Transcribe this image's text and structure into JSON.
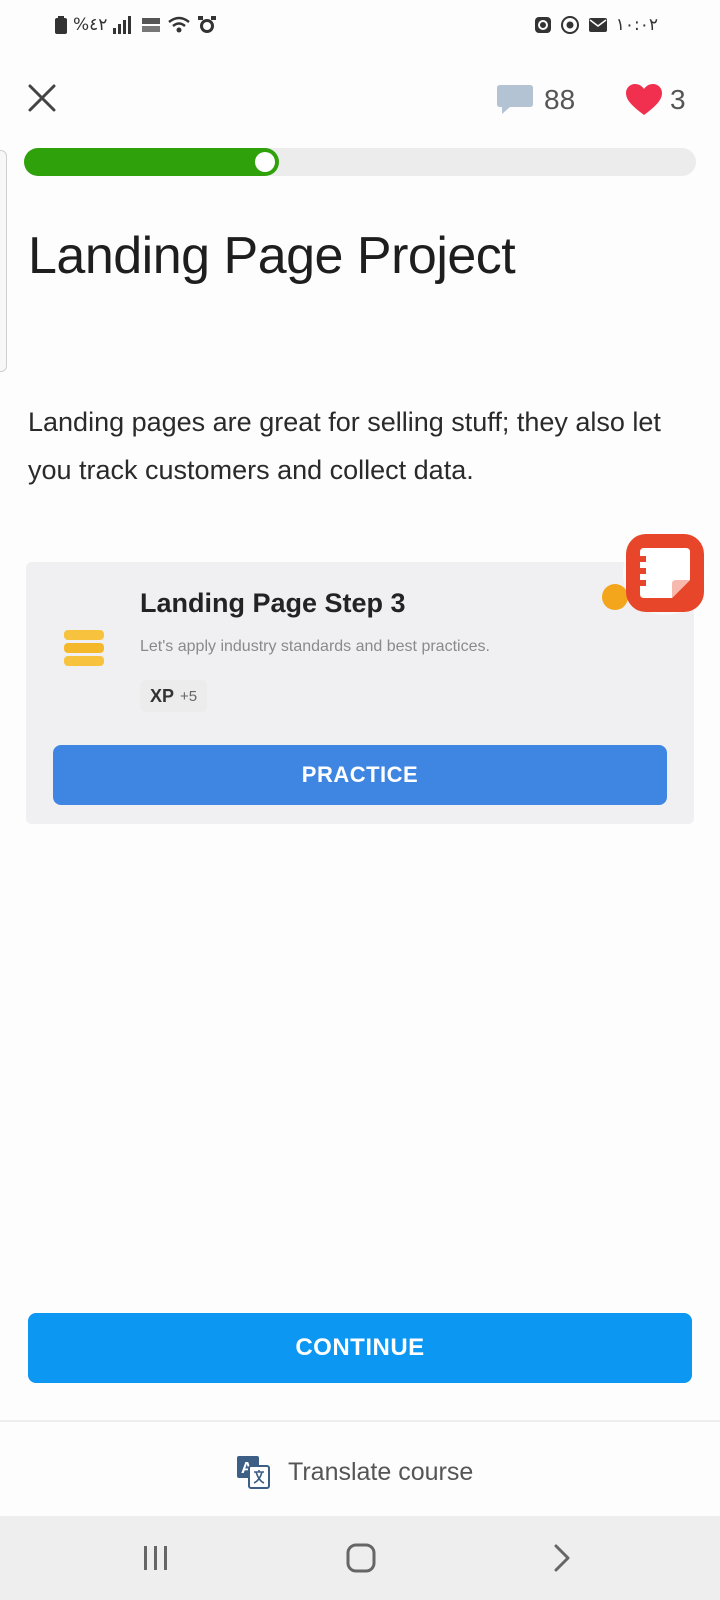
{
  "status_bar": {
    "left_text": "%٤٢",
    "right_time": "١٠:٠٢"
  },
  "header": {
    "comments_count": "88",
    "lives_count": "3"
  },
  "progress": {
    "fraction": 0.38
  },
  "lesson": {
    "title": "Landing Page Project",
    "description": "Landing pages are great for selling stuff; they also let you track customers and collect data."
  },
  "card": {
    "title": "Landing Page Step 3",
    "subtitle": "Let's apply industry standards and best practices.",
    "xp_label": "XP",
    "xp_value": "+5",
    "practice_label": "PRACTICE"
  },
  "footer": {
    "continue_label": "CONTINUE",
    "translate_label": "Translate course"
  },
  "colors": {
    "progress_green": "#2fa10b",
    "practice_blue": "#3f86e3",
    "continue_blue": "#0c97f2",
    "heart_red": "#f0304e",
    "note_orange": "#e8462a"
  },
  "icons": {
    "close": "close-icon",
    "comments": "speech-bubble-icon",
    "lives": "heart-icon",
    "lesson": "stack-icon",
    "translate": "translate-icon",
    "floating": "sticky-note-icon"
  }
}
